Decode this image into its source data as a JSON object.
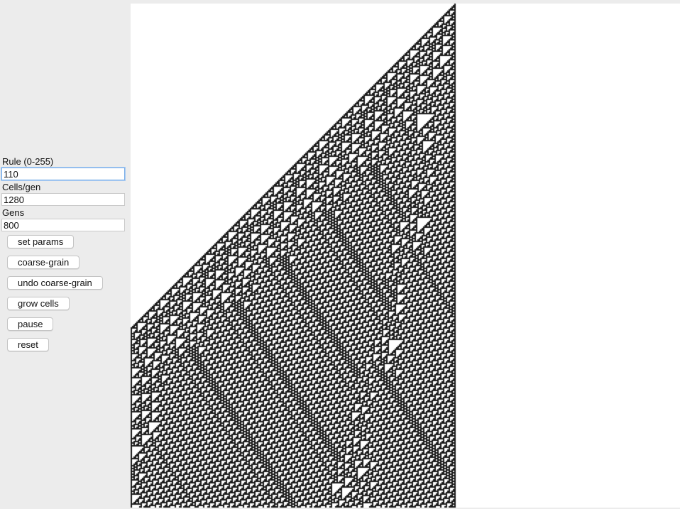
{
  "sidebar": {
    "rule_label": "Rule (0-255)",
    "rule_value": "110",
    "cells_label": "Cells/gen",
    "cells_value": "1280",
    "gens_label": "Gens",
    "gens_value": "800",
    "buttons": {
      "set_params": "set params",
      "coarse_grain": "coarse-grain",
      "undo_coarse_grain": "undo coarse-grain",
      "grow_cells": "grow cells",
      "pause": "pause",
      "reset": "reset"
    }
  },
  "automaton": {
    "rule": 110,
    "cell_color": "#1a1a1a",
    "background_color": "#ffffff"
  }
}
